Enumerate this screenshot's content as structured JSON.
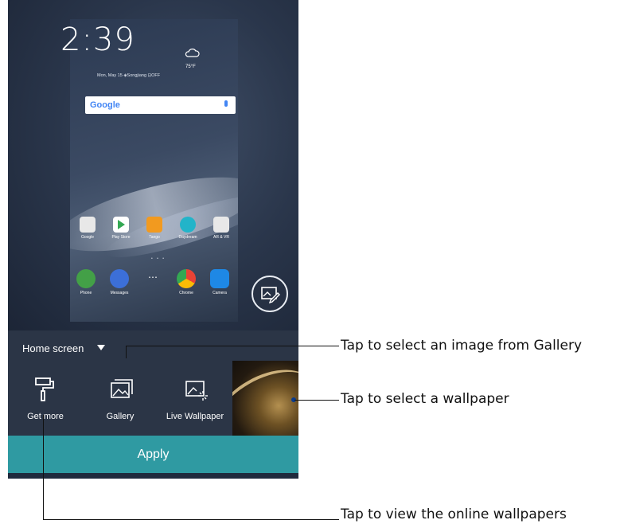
{
  "preview": {
    "clock": "2:39",
    "temperature": "75°F",
    "date_line": "Mon, May 15  ◈Songjiang  ⊡OFF",
    "search_logo": "Google",
    "apps": [
      {
        "label": "Google",
        "color": "#e8e8e8"
      },
      {
        "label": "Play Store",
        "color": "#ffffff"
      },
      {
        "label": "Tango",
        "color": "#f29a1f"
      },
      {
        "label": "Daydream",
        "color": "#22b4c9"
      },
      {
        "label": "AR & VR",
        "color": "#e8e8e8"
      }
    ],
    "dock": [
      {
        "label": "Phone",
        "color": "#43a047"
      },
      {
        "label": "Messages",
        "color": "#3c6fd8"
      },
      {
        "label": "",
        "color": "transparent"
      },
      {
        "label": "Chrome",
        "color": "#ffffff"
      },
      {
        "label": "Camera",
        "color": "#1e88e5"
      }
    ]
  },
  "sheet": {
    "title": "Home screen"
  },
  "options": [
    {
      "label": "Get more",
      "icon": "paint-roller-icon"
    },
    {
      "label": "Gallery",
      "icon": "gallery-icon"
    },
    {
      "label": "Live Wallpaper",
      "icon": "live-wallpaper-icon"
    }
  ],
  "apply_label": "Apply",
  "callouts": {
    "gallery": "Tap to select an image from Gallery",
    "wallpaper": "Tap to select a wallpaper",
    "online": "Tap to view the online wallpapers"
  },
  "colors": {
    "apply_bar": "#2f9aa2",
    "sheet_bg": "#2b3546"
  }
}
